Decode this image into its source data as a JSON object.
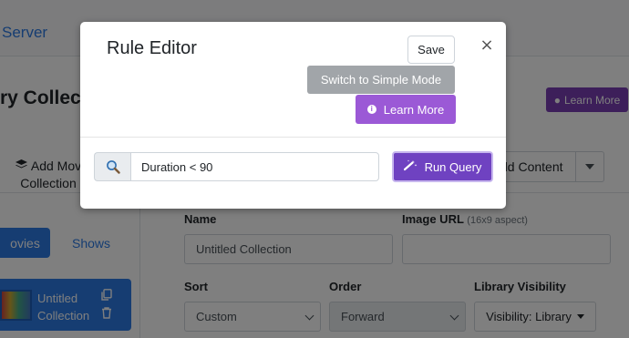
{
  "background": {
    "brand": "Server",
    "heading": "ry Collecti",
    "learn_more": "Learn More",
    "add_movie": "Add Movie Collection",
    "add_movie_line1": "Add Mov",
    "add_movie_line2": "Collection",
    "add_content": "dd Content",
    "tabs": {
      "movies": "ovies",
      "shows": "Shows"
    },
    "collection_item": {
      "line1": "Untitled",
      "line2": "Collection"
    },
    "form": {
      "name_label": "Name",
      "name_value": "Untitled Collection",
      "image_url_label": "Image URL",
      "image_url_hint": "(16x9 aspect)",
      "sort_label": "Sort",
      "sort_value": "Custom",
      "order_label": "Order",
      "order_value": "Forward",
      "visibility_label": "Library Visibility",
      "visibility_value": "Visibility: Library"
    }
  },
  "modal": {
    "title": "Rule Editor",
    "save_label": "Save",
    "close_glyph": "×",
    "switch_label": "Switch to Simple Mode",
    "learn_more_label": "Learn More",
    "info_glyph": "i",
    "query_value": "Duration < 90",
    "run_query_label": "Run Query"
  },
  "colors": {
    "primary": "#2c7be5",
    "run_query": "#6f42c1",
    "learn_more": "#9b59d6",
    "switch_mode": "#a1a5a9",
    "overlay": "rgba(0,0,0,0.5)"
  },
  "icons": {
    "search": "search-icon",
    "run": "magic-icon",
    "info": "info-icon",
    "close": "close-icon",
    "layers": "layers-icon",
    "copy": "copy-icon",
    "trash": "trash-icon"
  }
}
